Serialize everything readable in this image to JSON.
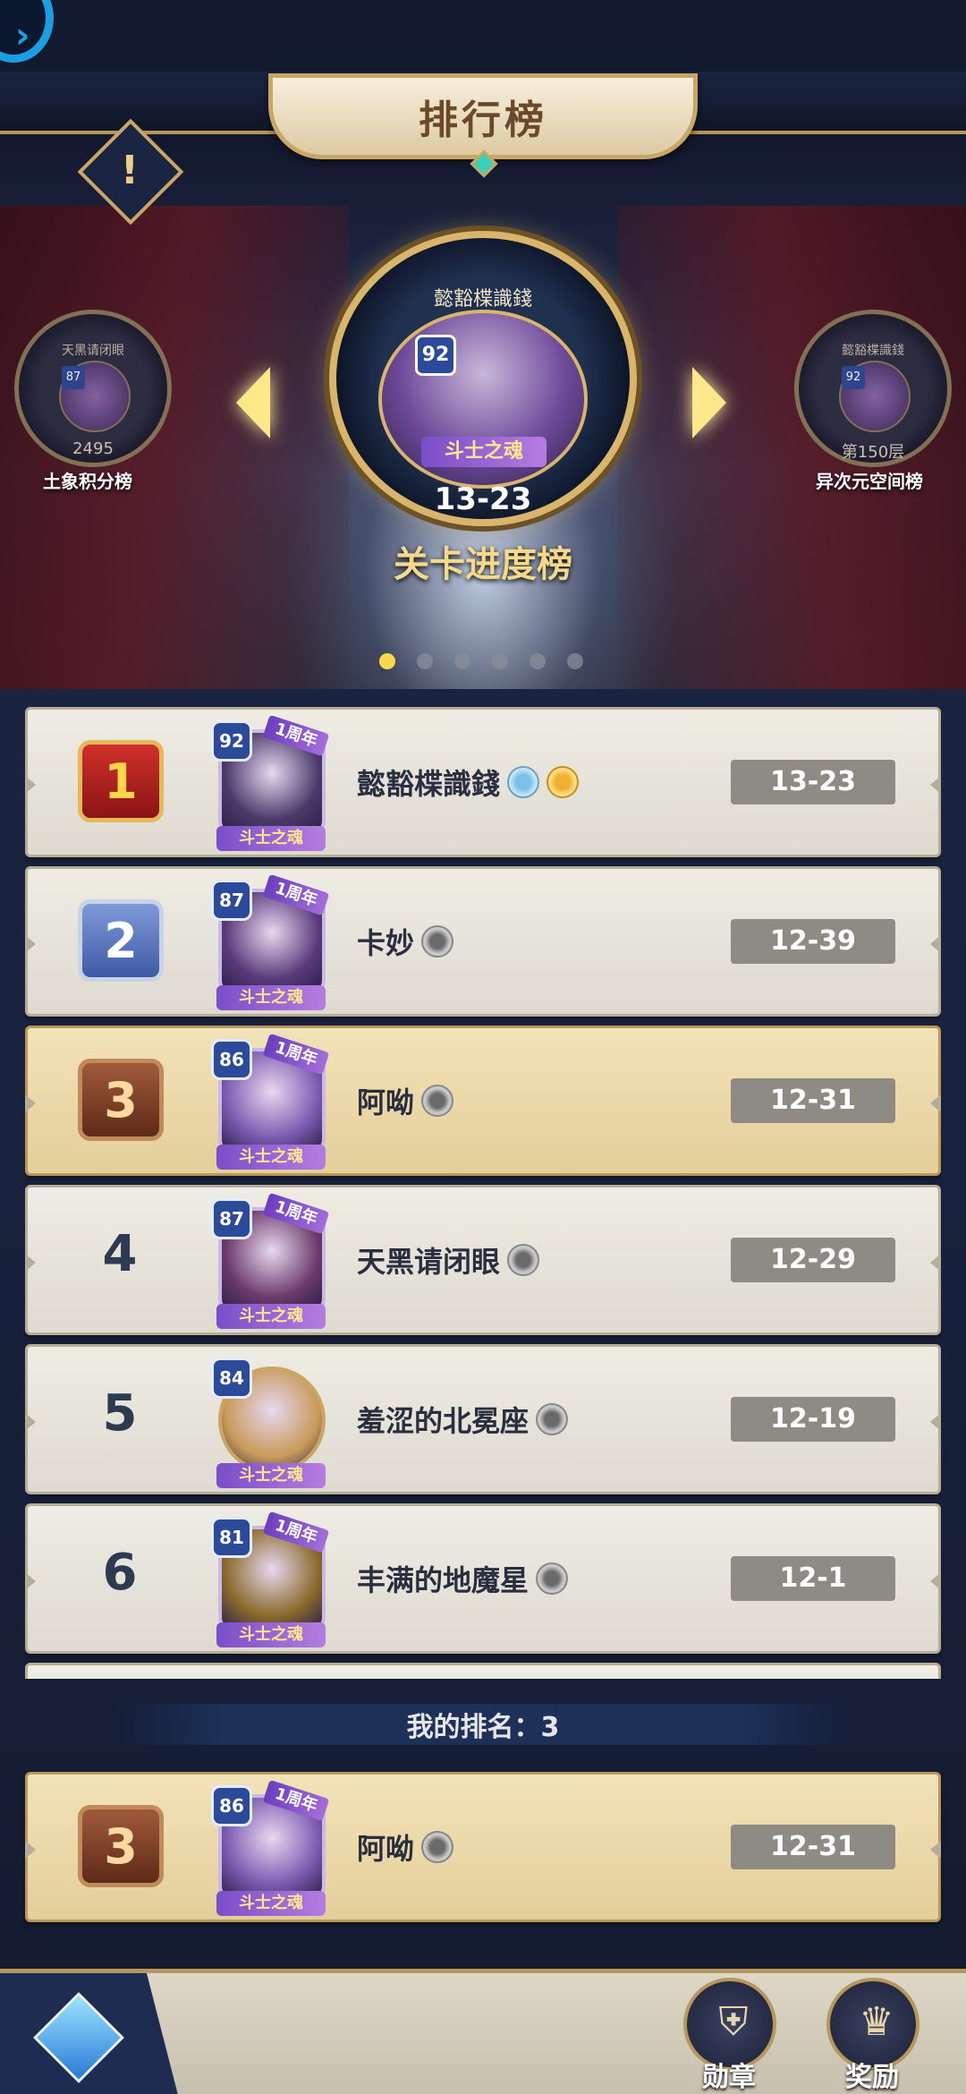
{
  "header": {
    "title": "排行榜",
    "info_glyph": "!"
  },
  "featured": {
    "player_name": "懿豁楪識錢",
    "level": "92",
    "tag": "斗士之魂",
    "value": "13-23",
    "board_name": "关卡进度榜"
  },
  "left_board": {
    "player_name": "天黑请闭眼",
    "level": "87",
    "value": "2495",
    "board_name": "土象积分榜"
  },
  "right_board": {
    "player_name": "懿豁楪識錢",
    "level": "92",
    "value": "第150层",
    "board_name": "异次元空间榜"
  },
  "carousel": {
    "count": 6,
    "active": 0
  },
  "rows": [
    {
      "rank": "1",
      "level": "92",
      "name": "懿豁楪識錢",
      "score": "13-23",
      "tag": "斗士之魂",
      "anniv": "1周年",
      "avatar_color": "#4a3a6a"
    },
    {
      "rank": "2",
      "level": "87",
      "name": "卡妙",
      "score": "12-39",
      "tag": "斗士之魂",
      "anniv": "1周年",
      "avatar_color": "#5a3a7a"
    },
    {
      "rank": "3",
      "level": "86",
      "name": "阿呦",
      "score": "12-31",
      "tag": "斗士之魂",
      "anniv": "1周年",
      "avatar_color": "#7a5ab0"
    },
    {
      "rank": "4",
      "level": "87",
      "name": "天黑请闭眼",
      "score": "12-29",
      "tag": "斗士之魂",
      "anniv": "1周年",
      "avatar_color": "#6a3a6a"
    },
    {
      "rank": "5",
      "level": "84",
      "name": "羞涩的北冕座",
      "score": "12-19",
      "tag": "斗士之魂",
      "anniv": "",
      "avatar_color": "#c89a5a"
    },
    {
      "rank": "6",
      "level": "81",
      "name": "丰满的地魔星",
      "score": "12-1",
      "tag": "斗士之魂",
      "anniv": "1周年",
      "avatar_color": "#8a6a2a"
    }
  ],
  "my_rank": {
    "label": "我的排名：3",
    "rank": "3",
    "level": "86",
    "name": "阿呦",
    "score": "12-31",
    "tag": "斗士之魂",
    "anniv": "1周年"
  },
  "footer": {
    "medal_label": "勋章",
    "reward_label": "奖励"
  },
  "colors": {
    "gold": "#c9a664",
    "rank1": "#c0302a",
    "rank2": "#5a78c0",
    "rank3": "#8a4a2a",
    "highlight_row": "#ecd9a8"
  }
}
